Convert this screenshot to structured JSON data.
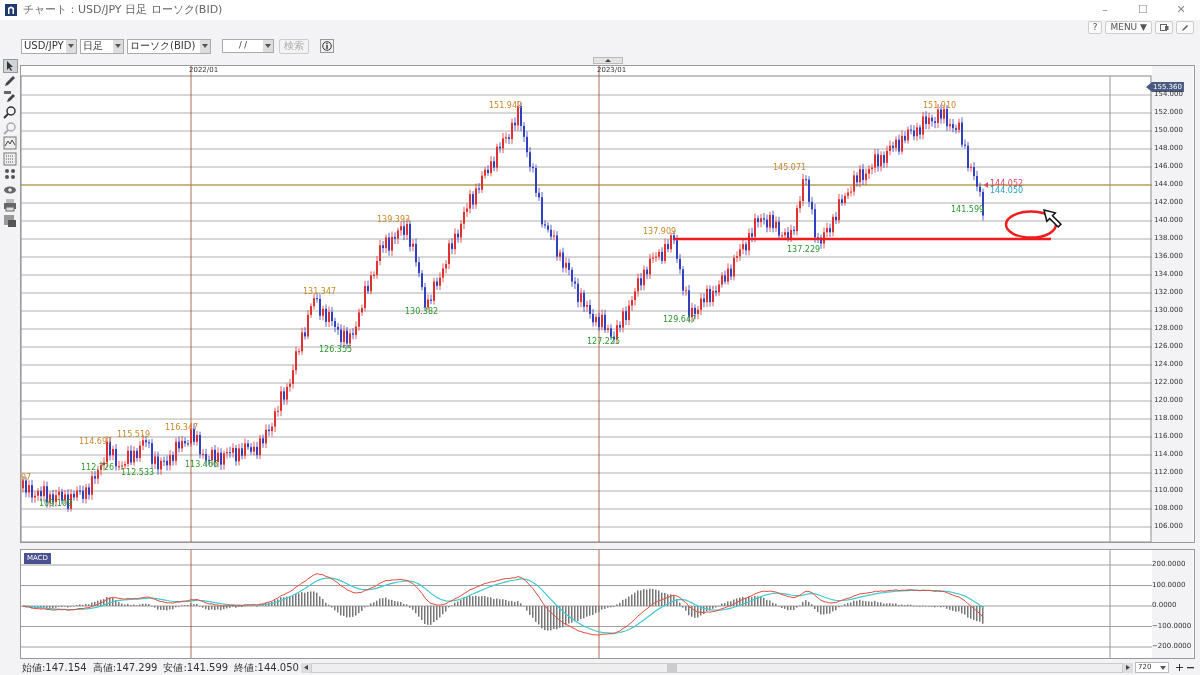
{
  "window": {
    "title": "チャート：USD/JPY 日足 ローソク(BID)",
    "controls": [
      "–",
      "☐",
      "✕"
    ]
  },
  "top_buttons": [
    {
      "kind": "text",
      "label": "?"
    },
    {
      "kind": "text",
      "label": "MENU ▼"
    },
    {
      "kind": "window"
    },
    {
      "kind": "pen"
    }
  ],
  "toolbar": {
    "symbol": "USD/JPY",
    "period": "日足",
    "chart_type": "ローソク(BID)",
    "date": "/ /",
    "search": {
      "label": "検索",
      "disabled": true
    }
  },
  "side_tools": [
    {
      "kind": "cursor",
      "selected": true
    },
    {
      "kind": "pen",
      "selected": false
    },
    {
      "kind": "allpen",
      "selected": false
    },
    {
      "kind": "zoomin",
      "selected": false
    },
    {
      "kind": "zoomout",
      "selected": false
    },
    {
      "kind": "chart",
      "selected": false
    },
    {
      "kind": "grid",
      "selected": false
    },
    {
      "kind": "dots",
      "selected": false
    },
    {
      "kind": "eye",
      "selected": false
    },
    {
      "kind": "print",
      "selected": false
    },
    {
      "kind": "export",
      "selected": false
    }
  ],
  "chart": {
    "dates": [
      "2022/01",
      "2023/01"
    ],
    "price_tag": "155.360",
    "y_labels": [
      "154.000",
      "152.000",
      "150.000",
      "148.000",
      "146.000",
      "144.000",
      "142.000",
      "140.000",
      "138.000",
      "136.000",
      "134.000",
      "132.000",
      "130.000",
      "128.000",
      "126.000",
      "124.000",
      "122.000",
      "120.000",
      "118.000",
      "116.000",
      "114.000",
      "112.000",
      "110.000",
      "108.000",
      "106.000"
    ],
    "annotations": [
      {
        "text": "97",
        "kind": "high"
      },
      {
        "text": "109.109",
        "kind": "low"
      },
      {
        "text": "114.697",
        "kind": "high"
      },
      {
        "text": "112.726",
        "kind": "low"
      },
      {
        "text": "115.519",
        "kind": "high"
      },
      {
        "text": "112.533",
        "kind": "low"
      },
      {
        "text": "116.347",
        "kind": "high"
      },
      {
        "text": "113.466",
        "kind": "low"
      },
      {
        "text": "131.347",
        "kind": "high"
      },
      {
        "text": "126.355",
        "kind": "low"
      },
      {
        "text": "139.393",
        "kind": "high"
      },
      {
        "text": "130.382",
        "kind": "low"
      },
      {
        "text": "151.942",
        "kind": "high"
      },
      {
        "text": "127.225",
        "kind": "low"
      },
      {
        "text": "137.909",
        "kind": "high"
      },
      {
        "text": "129.647",
        "kind": "low"
      },
      {
        "text": "145.071",
        "kind": "high"
      },
      {
        "text": "137.229",
        "kind": "low"
      },
      {
        "text": "151.910",
        "kind": "high"
      },
      {
        "text": "141.599",
        "kind": "low"
      }
    ],
    "ask": "144.052",
    "bid": "144.050"
  },
  "macd": {
    "label": "MACD",
    "y_labels": [
      "200.0000",
      "100.0000",
      "0.0000",
      "−100.0000",
      "−200.0000"
    ]
  },
  "status": {
    "items": [
      "始値:147.154",
      "高値:147.299",
      "安値:141.599",
      "終値:144.050"
    ],
    "count": "720"
  }
}
